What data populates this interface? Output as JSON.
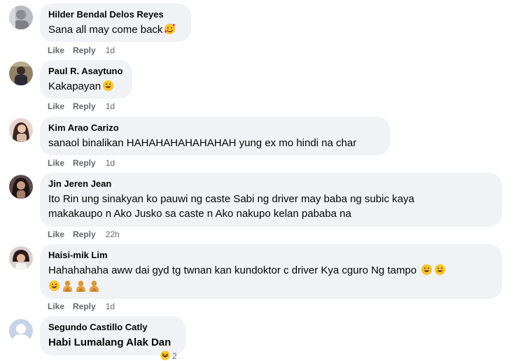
{
  "comments": [
    {
      "author": "Hilder Bendal Delos Reyes",
      "text": "Sana all may come back",
      "emoji": "smiling-face-hearts-icon",
      "like": "Like",
      "reply": "Reply",
      "time": "1d"
    },
    {
      "author": "Paul R. Asaytuno",
      "text": "Kakapayan",
      "emoji": "grinning-face-icon",
      "like": "Like",
      "reply": "Reply",
      "time": "1d"
    },
    {
      "author": "Kim Arao Carizo",
      "text": "sanaol binalikan HAHAHAHAHAHAHAH yung ex mo hindi na char",
      "like": "Like",
      "reply": "Reply",
      "time": "1d"
    },
    {
      "author": "Jin Jeren Jean",
      "line1": "Ito Rin ung sinakyan ko pauwi ng caste Sabi ng driver may baba ng subic kaya",
      "line2": "makakaupo n Ako Jusko sa caste n Ako nakupo kelan pababa na",
      "like": "Like",
      "reply": "Reply",
      "time": "22h"
    },
    {
      "author": "Haisi-mik Lim",
      "line1": "Hahahahaha aww dai gyd tg twnan kan kundoktor c driver Kya cguro Ng tampo",
      "like": "Like",
      "reply": "Reply",
      "time": "1d"
    },
    {
      "author": "Segundo Castillo Catly",
      "text": "Habi Lumalang Alak Dan",
      "reaction_count": "2"
    }
  ]
}
